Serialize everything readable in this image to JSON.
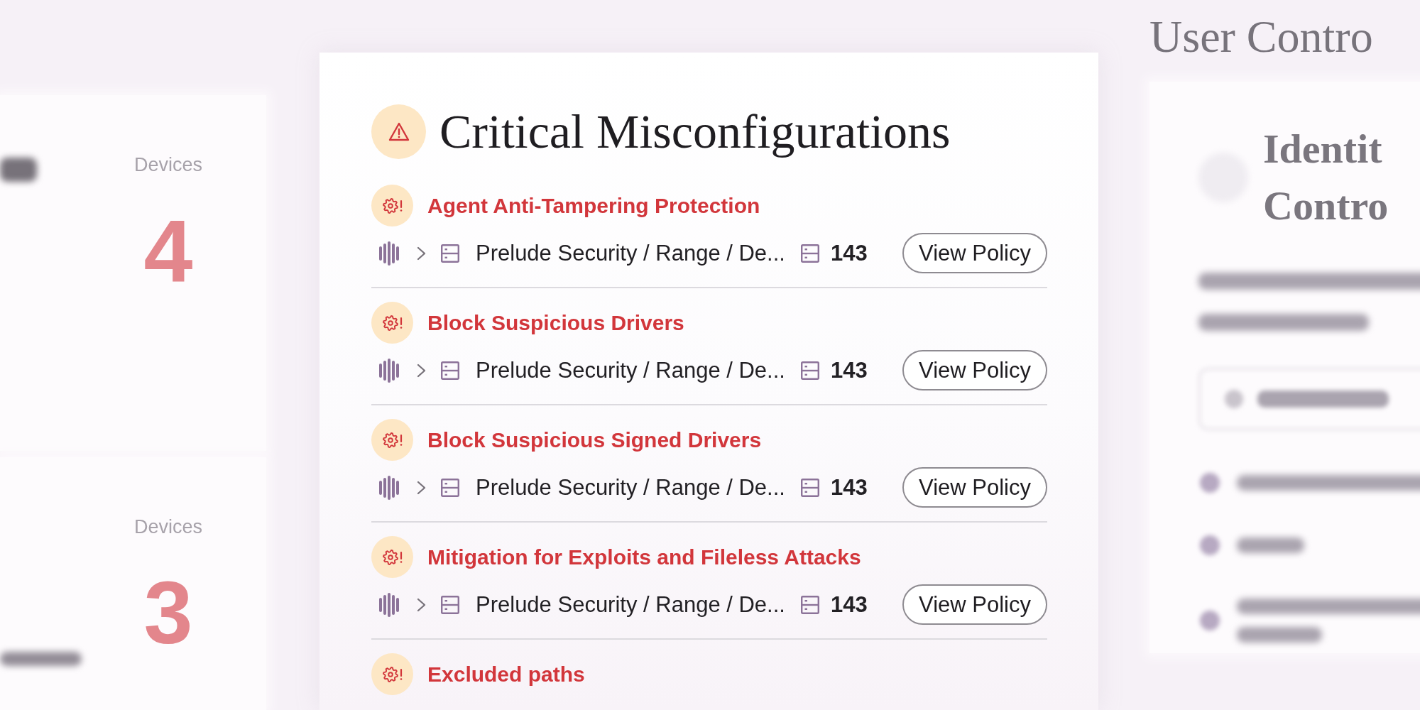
{
  "background_left": {
    "cards": [
      {
        "label": "Devices",
        "value": "4"
      },
      {
        "label": "Devices",
        "value": "3"
      }
    ]
  },
  "main_card": {
    "title": "Critical Misconfigurations",
    "items": [
      {
        "title": "Agent Anti-Tampering Protection",
        "detail": {
          "expanded": false,
          "path": "Prelude Security / Range / De...",
          "count": "143",
          "action": "View Policy"
        }
      },
      {
        "title": "Block Suspicious Drivers",
        "detail": {
          "expanded": false,
          "path": "Prelude Security / Range / De...",
          "count": "143",
          "action": "View Policy"
        }
      },
      {
        "title": "Block Suspicious Signed Drivers",
        "detail": {
          "expanded": false,
          "path": "Prelude Security / Range / De...",
          "count": "143",
          "action": "View Policy"
        }
      },
      {
        "title": "Mitigation for Exploits and Fileless Attacks",
        "detail": {
          "expanded": false,
          "path": "Prelude Security / Range / De...",
          "count": "143",
          "action": "View Policy"
        }
      },
      {
        "title": "Excluded paths"
      }
    ]
  },
  "background_right": {
    "heading": "User Contro",
    "card": {
      "title_lines": [
        "Identit",
        "Contro"
      ]
    }
  }
}
